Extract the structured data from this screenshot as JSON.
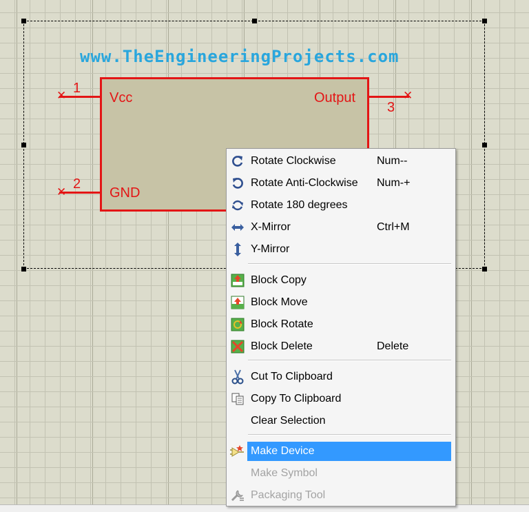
{
  "schematic": {
    "watermark": "www.TheEngineeringProjects.com",
    "pins": [
      {
        "number": "1",
        "label": "Vcc"
      },
      {
        "number": "2",
        "label": "GND"
      },
      {
        "number": "3",
        "label": "Output"
      }
    ]
  },
  "context_menu": {
    "items": [
      {
        "label": "Rotate Clockwise",
        "shortcut": "Num--",
        "icon": "rotate-clockwise-icon"
      },
      {
        "label": "Rotate Anti-Clockwise",
        "shortcut": "Num-+",
        "icon": "rotate-anticlockwise-icon"
      },
      {
        "label": "Rotate 180 degrees",
        "shortcut": "",
        "icon": "rotate-180-icon"
      },
      {
        "label": "X-Mirror",
        "shortcut": "Ctrl+M",
        "icon": "x-mirror-icon"
      },
      {
        "label": "Y-Mirror",
        "shortcut": "",
        "icon": "y-mirror-icon"
      },
      {
        "label": "Block Copy",
        "shortcut": "",
        "icon": "block-copy-icon"
      },
      {
        "label": "Block Move",
        "shortcut": "",
        "icon": "block-move-icon"
      },
      {
        "label": "Block Rotate",
        "shortcut": "",
        "icon": "block-rotate-icon"
      },
      {
        "label": "Block Delete",
        "shortcut": "Delete",
        "icon": "block-delete-icon"
      },
      {
        "label": "Cut To Clipboard",
        "shortcut": "",
        "icon": "scissors-icon"
      },
      {
        "label": "Copy To Clipboard",
        "shortcut": "",
        "icon": "copy-icon"
      },
      {
        "label": "Clear Selection",
        "shortcut": "",
        "icon": ""
      },
      {
        "label": "Make Device",
        "shortcut": "",
        "icon": "make-device-icon",
        "state": "highlighted"
      },
      {
        "label": "Make Symbol",
        "shortcut": "",
        "icon": "",
        "state": "disabled"
      },
      {
        "label": "Packaging Tool",
        "shortcut": "",
        "icon": "packaging-tool-icon",
        "state": "disabled"
      }
    ]
  },
  "colors": {
    "grid_background": "#dcdccc",
    "component_border": "#e31515",
    "component_fill": "#c7c3a6",
    "watermark": "#29a6dd",
    "menu_highlight": "#3399ff"
  }
}
